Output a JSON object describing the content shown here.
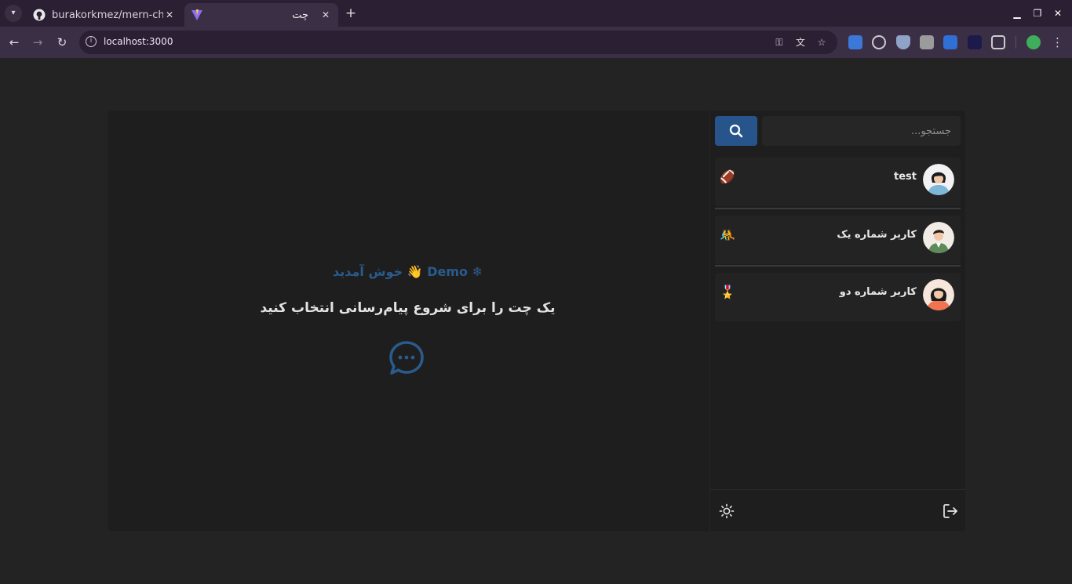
{
  "browser": {
    "tabs": [
      {
        "title": "burakorkmez/mern-chat",
        "favicon": "github-icon",
        "active": false
      },
      {
        "title": "چت",
        "favicon": "vite-icon",
        "active": true
      }
    ],
    "url": "localhost:3000"
  },
  "chat": {
    "search_placeholder": "جستجو...",
    "welcome_title": "خوش آمدید 👋 Demo ❄",
    "welcome_subtitle": "یک چت را برای شروع پیام‌رسانی انتخاب کنید",
    "contacts": [
      {
        "name": "test",
        "emoji": "🏈"
      },
      {
        "name": "کاربر شماره یک",
        "emoji": "🤼"
      },
      {
        "name": "کاربر شماره دو",
        "emoji": "🎖️"
      }
    ]
  },
  "colors": {
    "accent": "#27548a",
    "background": "#232323",
    "panel": "#1e1e1e"
  }
}
